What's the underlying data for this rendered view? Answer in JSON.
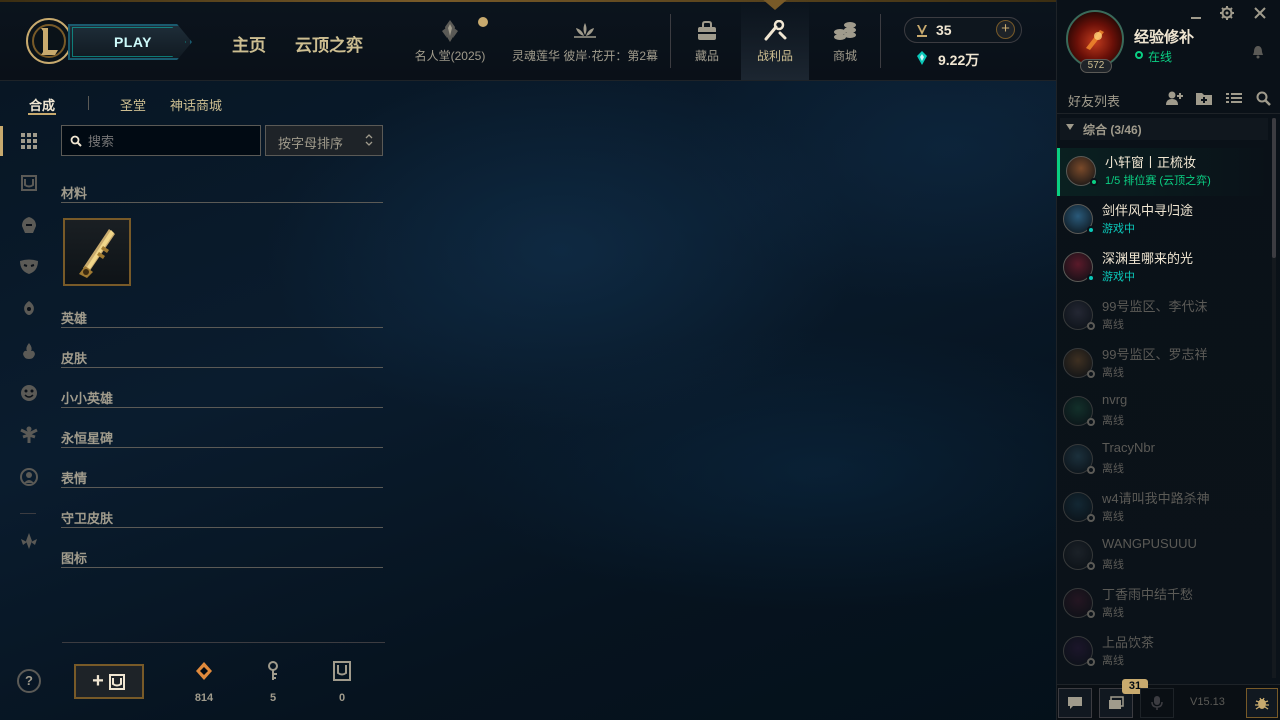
{
  "header": {
    "play_label": "PLAY",
    "nav_home": "主页",
    "nav_tft": "云顶之弈",
    "nav_items": [
      {
        "label": "名人堂(2025)",
        "icon": "hall-of-legends-icon"
      },
      {
        "label": "灵魂莲华 彼岸·花开：第2幕",
        "icon": "lotus-event-icon"
      },
      {
        "label": "藏品",
        "icon": "collection-bag-icon"
      },
      {
        "label": "战利品",
        "icon": "loot-icon"
      },
      {
        "label": "商城",
        "icon": "store-coins-icon"
      }
    ],
    "currency_rp": "35",
    "currency_be": "9.22万",
    "accent": "#c8aa6e"
  },
  "profile": {
    "name": "经验修补",
    "status": "在线",
    "level": "572"
  },
  "social": {
    "title": "好友列表",
    "group_label": "综合 (3/46)",
    "friends": [
      {
        "name": "小轩窗丨正梳妆",
        "status": "1/5 排位赛 (云顶之弈)",
        "state": "lobby"
      },
      {
        "name": "剑伴风中寻归途",
        "status": "游戏中",
        "state": "ingame"
      },
      {
        "name": "深渊里哪来的光",
        "status": "游戏中",
        "state": "ingame"
      },
      {
        "name": "99号监区、李代沫",
        "status": "离线",
        "state": "offline"
      },
      {
        "name": "99号监区、罗志祥",
        "status": "离线",
        "state": "offline"
      },
      {
        "name": "nvrg",
        "status": "离线",
        "state": "offline"
      },
      {
        "name": "TracyNbr",
        "status": "离线",
        "state": "offline"
      },
      {
        "name": "w4请叫我中路杀神",
        "status": "离线",
        "state": "offline"
      },
      {
        "name": "WANGPUSUUU",
        "status": "离线",
        "state": "offline"
      },
      {
        "name": "丁香雨中结千愁",
        "status": "离线",
        "state": "offline"
      },
      {
        "name": "上品饮茶",
        "status": "离线",
        "state": "offline"
      }
    ],
    "notification_count": "31",
    "version": "V15.13",
    "status_colors": {
      "online": "#0acf83",
      "ingame": "#0ac8b9",
      "offline": "#5b5a56"
    }
  },
  "loot": {
    "tabs": [
      "合成",
      "圣堂",
      "神话商城"
    ],
    "search_placeholder": "搜索",
    "sort_label": "按字母排序",
    "categories": [
      "材料",
      "英雄",
      "皮肤",
      "小小英雄",
      "永恒星碑",
      "表情",
      "守卫皮肤",
      "图标"
    ],
    "material_item": "hextech-key-icon",
    "stats": {
      "orange_essence": "814",
      "keys": "5",
      "chests": "0"
    }
  }
}
